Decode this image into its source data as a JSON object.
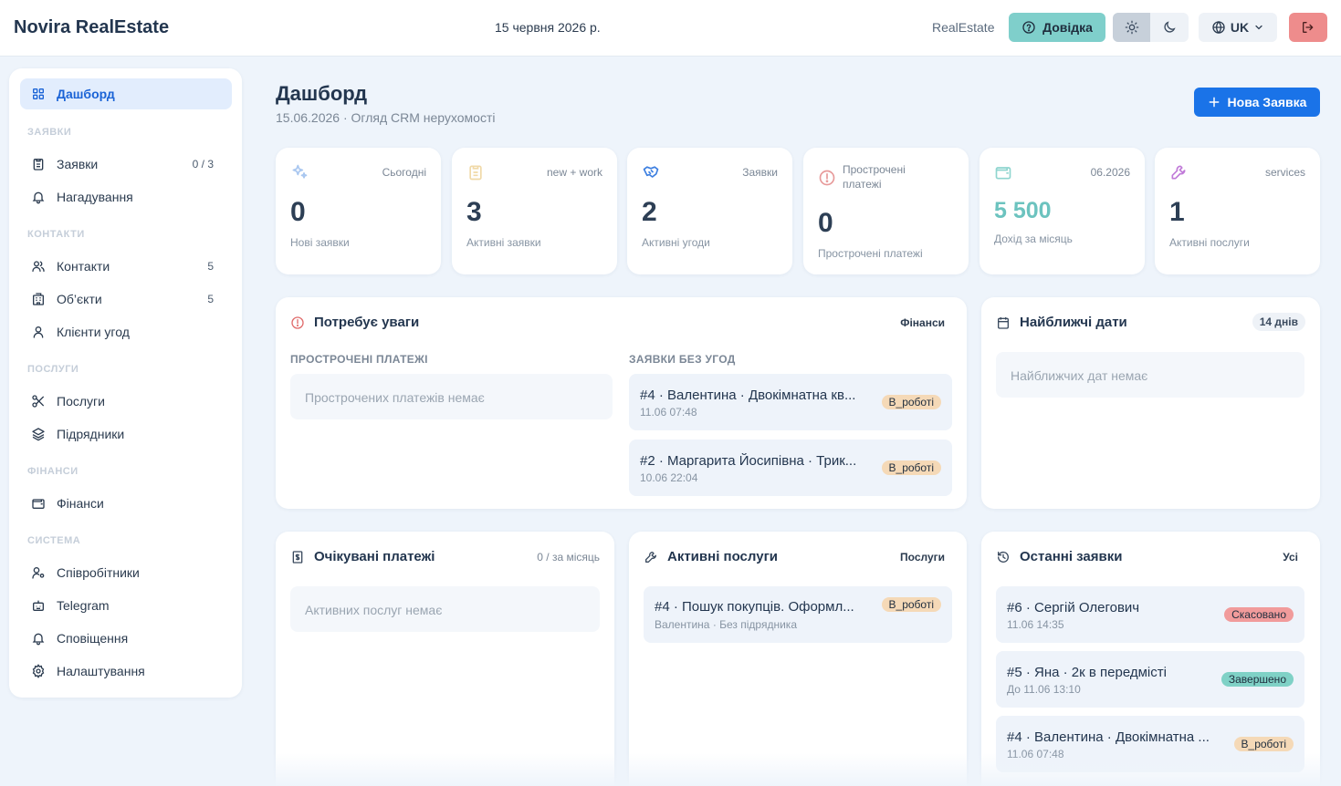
{
  "header": {
    "brand": "Novira RealEstate",
    "date": "15 червня 2026 р.",
    "app_label": "RealEstate",
    "help_label": "Довідка",
    "language": "UK"
  },
  "sidebar": {
    "dashboard": "Дашборд",
    "sections": {
      "requests": "ЗАЯВКИ",
      "contacts": "КОНТАКТИ",
      "services": "ПОСЛУГИ",
      "finance": "ФІНАНСИ",
      "system": "СИСТЕМА"
    },
    "items": {
      "requests": {
        "label": "Заявки",
        "count": "0 / 3"
      },
      "reminders": {
        "label": "Нагадування"
      },
      "contacts": {
        "label": "Контакти",
        "count": "5"
      },
      "objects": {
        "label": "Об’єкти",
        "count": "5"
      },
      "deal_clients": {
        "label": "Клієнти угод"
      },
      "services": {
        "label": "Послуги"
      },
      "contractors": {
        "label": "Підрядники"
      },
      "finance": {
        "label": "Фінанси"
      },
      "employees": {
        "label": "Співробітники"
      },
      "telegram": {
        "label": "Telegram"
      },
      "notifications": {
        "label": "Сповіщення"
      },
      "settings": {
        "label": "Налаштування"
      }
    }
  },
  "page": {
    "title": "Дашборд",
    "subtitle": "15.06.2026 · Огляд CRM нерухомості",
    "new_button": "Нова Заявка"
  },
  "stats": [
    {
      "label": "Сьогодні",
      "value": "0",
      "caption": "Нові заявки",
      "icon": "sparkles-icon"
    },
    {
      "label": "new + work",
      "value": "3",
      "caption": "Активні заявки",
      "icon": "clipboard-icon"
    },
    {
      "label": "Заявки",
      "value": "2",
      "caption": "Активні угоди",
      "icon": "handshake-icon"
    },
    {
      "label": "Прострочені платежі",
      "value": "0",
      "caption": "Прострочені платежі",
      "icon": "alert-circle-icon"
    },
    {
      "label": "06.2026",
      "value": "5 500",
      "caption": "Дохід за місяць",
      "icon": "wallet-icon"
    },
    {
      "label": "services",
      "value": "1",
      "caption": "Активні послуги",
      "icon": "wrench-icon"
    }
  ],
  "attention": {
    "title": "Потребує уваги",
    "link": "Фінанси",
    "overdue_head": "ПРОСТРОЧЕНІ ПЛАТЕЖІ",
    "overdue_empty": "Прострочених платежів немає",
    "no_deals_head": "ЗАЯВКИ БЕЗ УГОД",
    "rows": [
      {
        "title": "#4 · Валентина · Двокімнатна кв...",
        "sub": "11.06 07:48",
        "badge": "В_роботі"
      },
      {
        "title": "#2 · Маргарита Йосипівна · Трик...",
        "sub": "10.06 22:04",
        "badge": "В_роботі"
      }
    ]
  },
  "dates": {
    "title": "Найближчі дати",
    "pill": "14 днів",
    "empty": "Найближчих дат немає"
  },
  "expected": {
    "title": "Очікувані платежі",
    "tag": "0 / за місяць",
    "empty": "Активних послуг немає"
  },
  "active_services": {
    "title": "Активні послуги",
    "link": "Послуги",
    "rows": [
      {
        "title": "#4 · Пошук покупців. Оформл...",
        "sub": "Валентина · Без підрядника",
        "badge": "В_роботі"
      }
    ]
  },
  "recent": {
    "title": "Останні заявки",
    "link": "Усі",
    "rows": [
      {
        "title": "#6 · Сергій Олегович",
        "sub": "11.06 14:35",
        "badge": "Скасовано"
      },
      {
        "title": "#5 · Яна · 2к в передмісті",
        "sub": "До 11.06 13:10",
        "badge": "Завершено"
      },
      {
        "title": "#4 · Валентина · Двокімнатна ...",
        "sub": "11.06 07:48",
        "badge": "В_роботі"
      }
    ]
  },
  "colors": {
    "accent": "#1a73e8",
    "help": "#7fcfcb",
    "logout": "#ee8c8c",
    "income": "#6cc3bf",
    "badge_work": "#f5d9b7",
    "badge_cancel": "#f19b9b",
    "badge_done": "#7fd1c6"
  }
}
